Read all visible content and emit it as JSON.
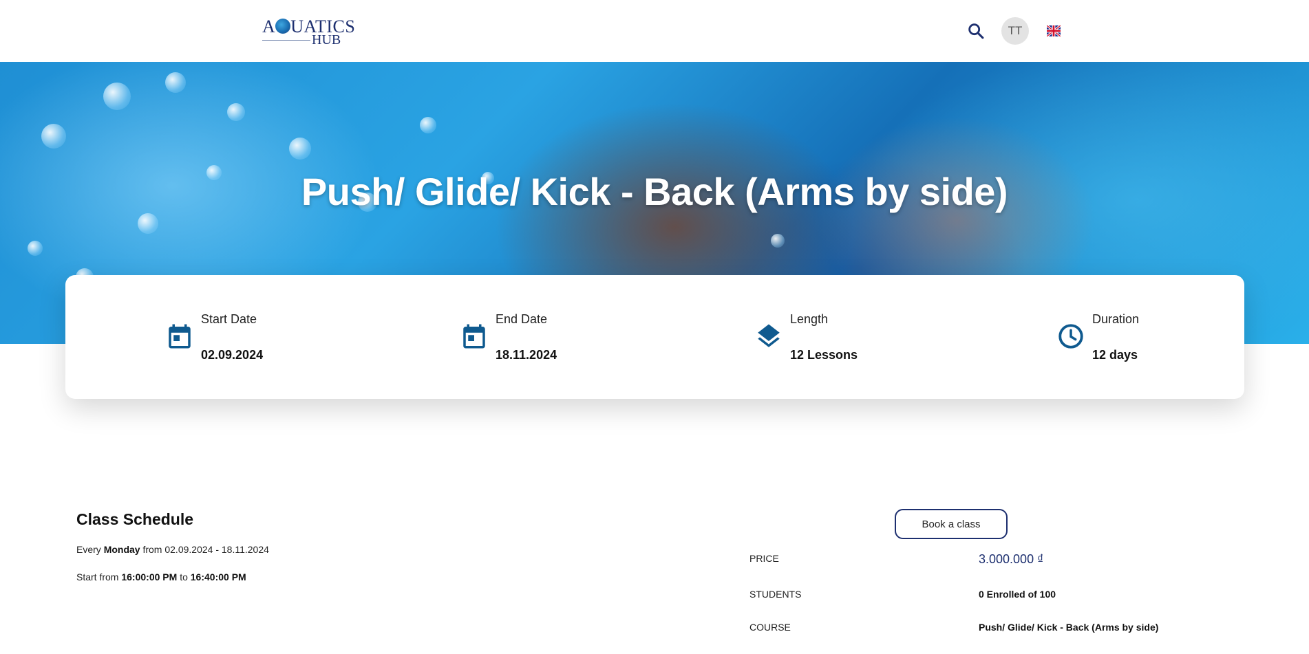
{
  "header": {
    "logo_top": "A",
    "logo_top_rest": "UATICS",
    "logo_hub": "HUB",
    "avatar_initials": "TT"
  },
  "hero": {
    "title": "Push/ Glide/ Kick - Back (Arms by side)"
  },
  "info": [
    {
      "label": "Start Date",
      "value": "02.09.2024",
      "icon": "calendar-icon"
    },
    {
      "label": "End Date",
      "value": "18.11.2024",
      "icon": "calendar-icon"
    },
    {
      "label": "Length",
      "value": "12 Lessons",
      "icon": "layers-icon"
    },
    {
      "label": "Duration",
      "value": "12 days",
      "icon": "clock-icon"
    }
  ],
  "schedule": {
    "title": "Class Schedule",
    "every_prefix": "Every",
    "day": "Monday",
    "range_text": "from 02.09.2024 - 18.11.2024",
    "start_prefix": "Start from",
    "start_time": "16:00:00 PM",
    "to_text": "to",
    "end_time": "16:40:00 PM"
  },
  "booking": {
    "button_label": "Book a class",
    "price_label": "PRICE",
    "price_value": "3.000.000 ₫",
    "students_label": "STUDENTS",
    "students_value": "0 Enrolled of 100",
    "course_label": "COURSE",
    "course_value": "Push/ Glide/ Kick - Back (Arms by side)"
  },
  "colors": {
    "brand": "#1d2f6f",
    "icon_blue": "#0f5a8f"
  }
}
